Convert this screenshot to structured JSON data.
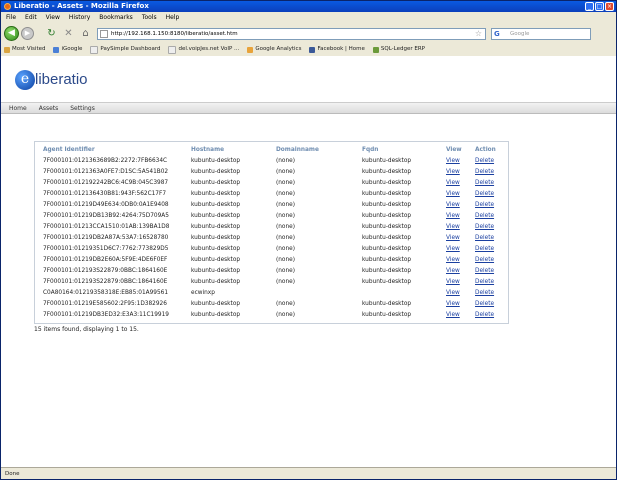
{
  "window": {
    "title": "Liberatio - Assets - Mozilla Firefox"
  },
  "menu": [
    "File",
    "Edit",
    "View",
    "History",
    "Bookmarks",
    "Tools",
    "Help"
  ],
  "toolbar": {
    "url": "http://192.168.1.150:8180/liberatio/asset.htm",
    "search_placeholder": "Google"
  },
  "bookmarks": [
    "Most Visited",
    "iGoogle",
    "PaySimple Dashboard",
    "del.voipJes.net VoIP ...",
    "Google Analytics",
    "Facebook | Home",
    "SQL-Ledger ERP"
  ],
  "site": {
    "logo_text": "liberatio",
    "logo_letter": "e",
    "nav": [
      "Home",
      "Assets",
      "Settings"
    ]
  },
  "table": {
    "headers": [
      "Agent Identifier",
      "Hostname",
      "Domainname",
      "Fqdn",
      "View",
      "Action"
    ],
    "rows": [
      [
        "7F000101:0121363689B2:2272:7FB6634C",
        "kubuntu-desktop",
        "(none)",
        "kubuntu-desktop",
        "View",
        "Delete"
      ],
      [
        "7F000101:0121363A0FE7:D1SC:5A541B02",
        "kubuntu-desktop",
        "(none)",
        "kubuntu-desktop",
        "View",
        "Delete"
      ],
      [
        "7F000101:012192242BC6:4C9B:045C3987",
        "kubuntu-desktop",
        "(none)",
        "kubuntu-desktop",
        "View",
        "Delete"
      ],
      [
        "7F000101:012136430B81:943F:562C17F7",
        "kubuntu-desktop",
        "(none)",
        "kubuntu-desktop",
        "View",
        "Delete"
      ],
      [
        "7F000101:01219D49E634:0DB0:0A1E9408",
        "kubuntu-desktop",
        "(none)",
        "kubuntu-desktop",
        "View",
        "Delete"
      ],
      [
        "7F000101:01219DB13B92:4264:75D709A5",
        "kubuntu-desktop",
        "(none)",
        "kubuntu-desktop",
        "View",
        "Delete"
      ],
      [
        "7F000101:01213CCA1510:01AB:139BA1D8",
        "kubuntu-desktop",
        "(none)",
        "kubuntu-desktop",
        "View",
        "Delete"
      ],
      [
        "7F000101:01219DB2A87A:53A7:16528780",
        "kubuntu-desktop",
        "(none)",
        "kubuntu-desktop",
        "View",
        "Delete"
      ],
      [
        "7F000101:01219351D6C7:7762:773829D5",
        "kubuntu-desktop",
        "(none)",
        "kubuntu-desktop",
        "View",
        "Delete"
      ],
      [
        "7F000101:01219DB2E60A:5F9E:4DE6F0EF",
        "kubuntu-desktop",
        "(none)",
        "kubuntu-desktop",
        "View",
        "Delete"
      ],
      [
        "7F000101:012193S22879:0BBC:1864160E",
        "kubuntu-desktop",
        "(none)",
        "kubuntu-desktop",
        "View",
        "Delete"
      ],
      [
        "7F000101:012193S22879:0BBC:1864160E",
        "kubuntu-desktop",
        "(none)",
        "kubuntu-desktop",
        "View",
        "Delete"
      ],
      [
        "C0A80164:01219358318E:EB85:01A99561",
        "ecwinxp",
        "",
        "",
        "View",
        "Delete"
      ],
      [
        "7F000101:01219E585602:2F95:1D382926",
        "kubuntu-desktop",
        "(none)",
        "kubuntu-desktop",
        "View",
        "Delete"
      ],
      [
        "7F000101:01219DB3ED32:E3A3:11C19919",
        "kubuntu-desktop",
        "(none)",
        "kubuntu-desktop",
        "View",
        "Delete"
      ]
    ],
    "summary": "15 items found, displaying 1 to 15."
  },
  "status": "Done",
  "colors": {
    "titlebar": "#0b4fd1",
    "header_text": "#6f8db0",
    "link": "#1a3fa0"
  }
}
